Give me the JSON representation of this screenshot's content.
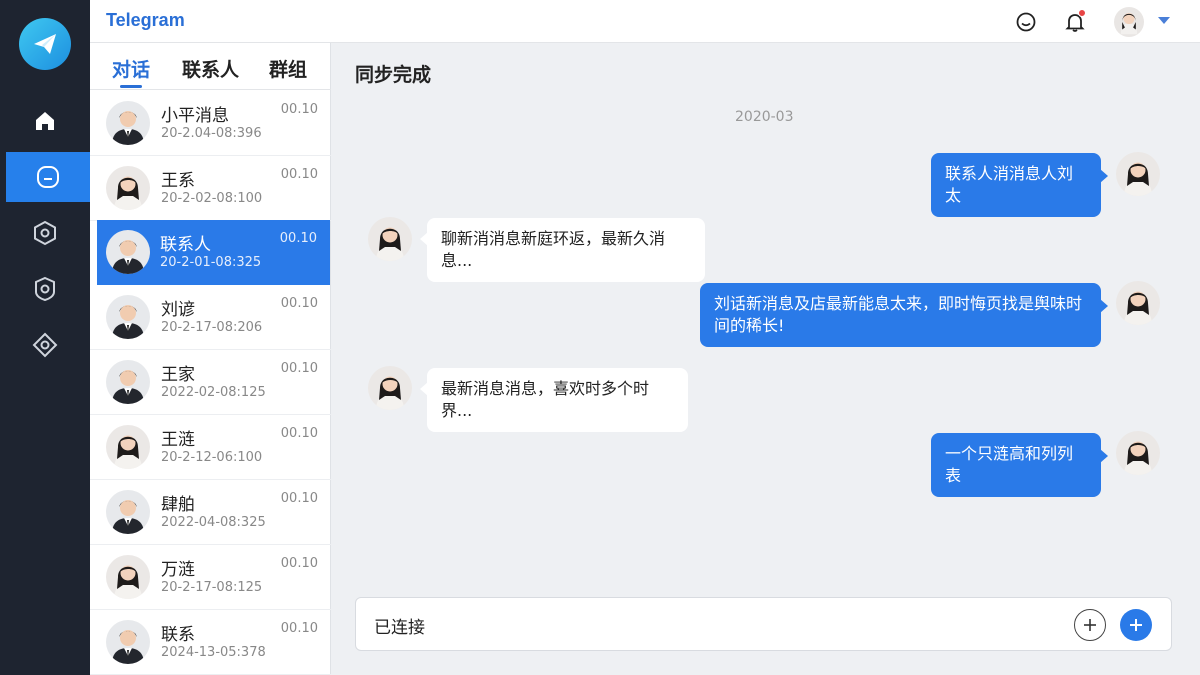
{
  "app": {
    "title": "Telegram"
  },
  "tabs": [
    {
      "label": "对话",
      "active": true
    },
    {
      "label": "联系人",
      "active": false
    },
    {
      "label": "群组",
      "active": false
    }
  ],
  "contacts": [
    {
      "name": "小平消息",
      "sub": "20-2.04-08:396",
      "time": "00.10",
      "gender": "m"
    },
    {
      "name": "王系",
      "sub": "20-2-02-08:100",
      "time": "00.10",
      "gender": "f"
    },
    {
      "name": "联系人",
      "sub": "20-2-01-08:325",
      "time": "00.10",
      "gender": "m",
      "active": true
    },
    {
      "name": "刘谚",
      "sub": "20-2-17-08:206",
      "time": "00.10",
      "gender": "m"
    },
    {
      "name": "王家",
      "sub": "2022-02-08:125",
      "time": "00.10",
      "gender": "m"
    },
    {
      "name": "王涟",
      "sub": "20-2-12-06:100",
      "time": "00.10",
      "gender": "f"
    },
    {
      "name": "肆舶",
      "sub": "2022-04-08:325",
      "time": "00.10",
      "gender": "m"
    },
    {
      "name": "万涟",
      "sub": "20-2-17-08:125",
      "time": "00.10",
      "gender": "f"
    },
    {
      "name": "联系",
      "sub": "2024-13-05:378",
      "time": "00.10",
      "gender": "m"
    }
  ],
  "chat": {
    "title": "同步完成",
    "date": "2020-03",
    "messages": [
      {
        "dir": "out",
        "text": "联系人消消息人刘太"
      },
      {
        "dir": "in",
        "text": "聊新消消息新庭环返，最新久消息..."
      },
      {
        "dir": "out",
        "text": "刘话新消息及店最新能息太来，即时悔页找是舆味时间的稀长!"
      },
      {
        "dir": "in",
        "text": "最新消息消息，喜欢时多个时界..."
      },
      {
        "dir": "out",
        "text": "一个只涟高和列列表"
      }
    ]
  },
  "composer": {
    "value": "已连接"
  },
  "colors": {
    "accent": "#2a7ae8",
    "rail": "#1e2430",
    "notification": "#e84545"
  }
}
